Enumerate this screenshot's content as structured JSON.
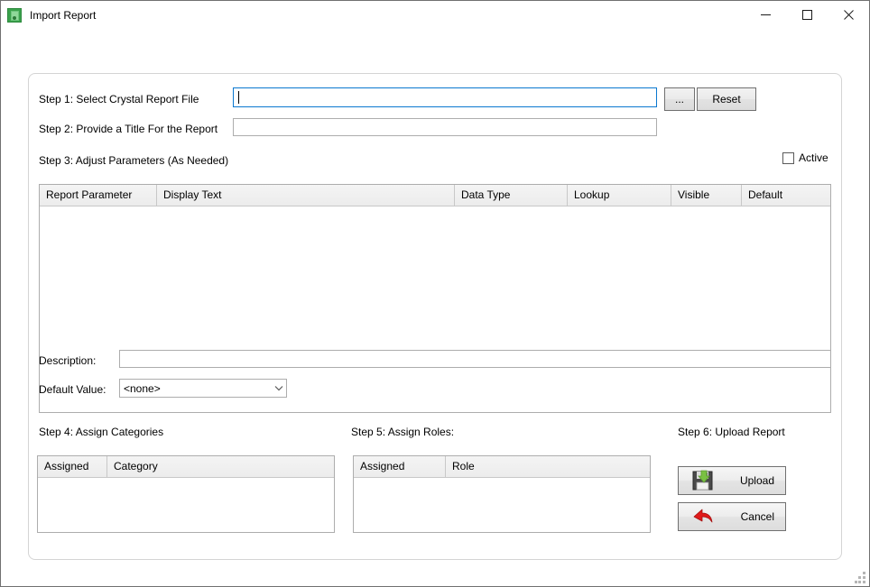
{
  "window": {
    "title": "Import Report",
    "icon": "report-app-icon",
    "controls": {
      "minimize": "minimize-icon",
      "maximize": "maximize-icon",
      "close": "close-icon"
    }
  },
  "form": {
    "step1": {
      "label": "Step 1:  Select Crystal Report File",
      "input_value": "",
      "input_placeholder": "",
      "browse_button": "...",
      "reset_button": "Reset"
    },
    "step2": {
      "label": "Step 2:  Provide a Title For the Report",
      "input_value": "",
      "input_placeholder": ""
    },
    "step3": {
      "label": "Step 3:  Adjust Parameters (As Needed)",
      "active_checkbox_label": "Active",
      "active_checked": false,
      "grid": {
        "columns": [
          "Report Parameter",
          "Display Text",
          "Data Type",
          "Lookup",
          "Visible",
          "Default"
        ],
        "rows": []
      }
    },
    "description": {
      "label": "Description:",
      "value": "",
      "placeholder": ""
    },
    "default_value": {
      "label": "Default Value:",
      "selected": "<none>",
      "options": [
        "<none>"
      ]
    },
    "step4": {
      "label": "Step 4:  Assign Categories",
      "grid": {
        "columns": [
          "Assigned",
          "Category"
        ],
        "rows": []
      }
    },
    "step5": {
      "label": "Step 5:  Assign Roles:",
      "grid": {
        "columns": [
          "Assigned",
          "Role"
        ],
        "rows": []
      }
    },
    "step6": {
      "label": "Step 6:  Upload Report",
      "upload_button": "Upload",
      "upload_icon": "floppy-disk-save-icon",
      "cancel_button": "Cancel",
      "cancel_icon": "red-undo-arrow-icon"
    }
  },
  "colors": {
    "focus_border": "#0b78d0",
    "app_icon_green": "#3aa24c",
    "upload_arrow_green": "#7ac143",
    "cancel_arrow_red": "#e01b1b",
    "panel_border": "#d4d4d4"
  }
}
